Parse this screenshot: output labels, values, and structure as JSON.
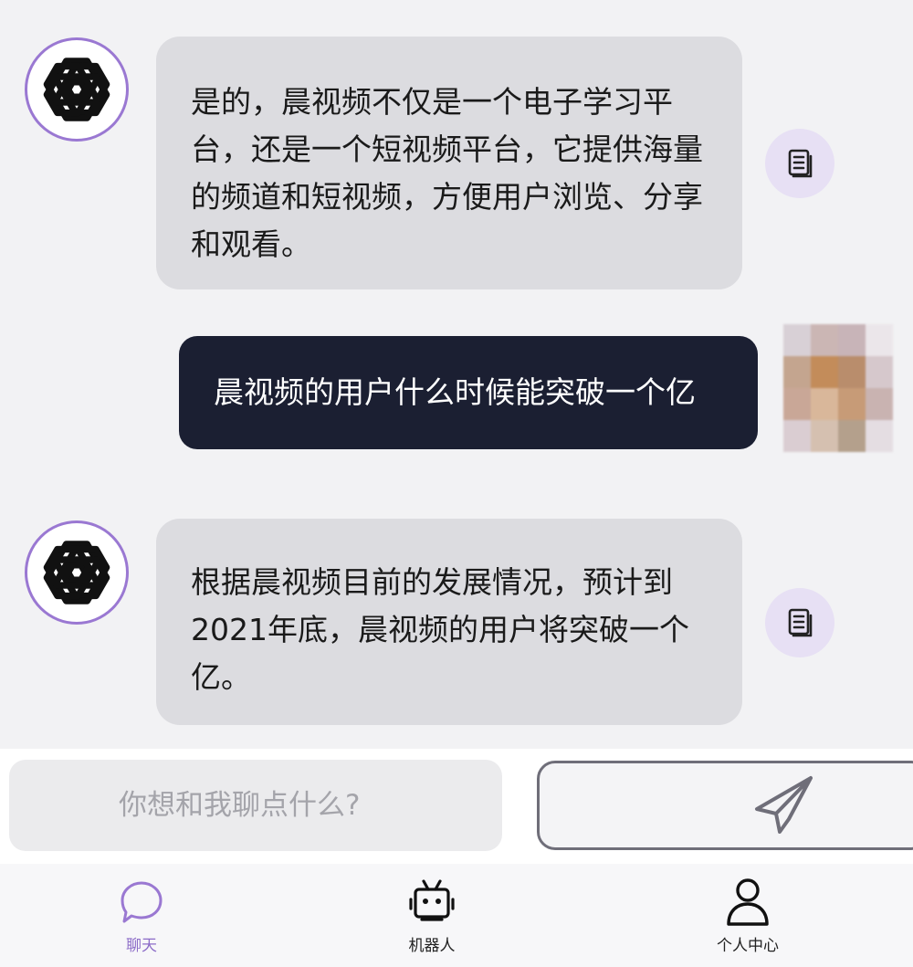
{
  "messages": [
    {
      "role": "bot",
      "text": "是的，晨视频不仅是一个电子学习平台，还是一个短视频平台，它提供海量的频道和短视频，方便用户浏览、分享和观看。"
    },
    {
      "role": "user",
      "text": "晨视频的用户什么时候能突破一个亿"
    },
    {
      "role": "bot",
      "text": "根据晨视频目前的发展情况，预计到2021年底，晨视频的用户将突破一个亿。"
    }
  ],
  "input": {
    "placeholder": "你想和我聊点什么?",
    "value": ""
  },
  "icons": {
    "bot_avatar": "openai-logo-icon",
    "copy": "copy-document-icon",
    "send": "paper-plane-icon",
    "tab_chat": "chat-bubble-icon",
    "tab_robot": "robot-tv-icon",
    "tab_profile": "person-icon"
  },
  "tabs": [
    {
      "label": "聊天",
      "active": true
    },
    {
      "label": "机器人",
      "active": false
    },
    {
      "label": "个人中心",
      "active": false
    }
  ],
  "colors": {
    "accent": "#9a78d2",
    "bot_bubble": "#dcdce0",
    "user_bubble": "#1b1f32",
    "background": "#f2f2f4"
  }
}
